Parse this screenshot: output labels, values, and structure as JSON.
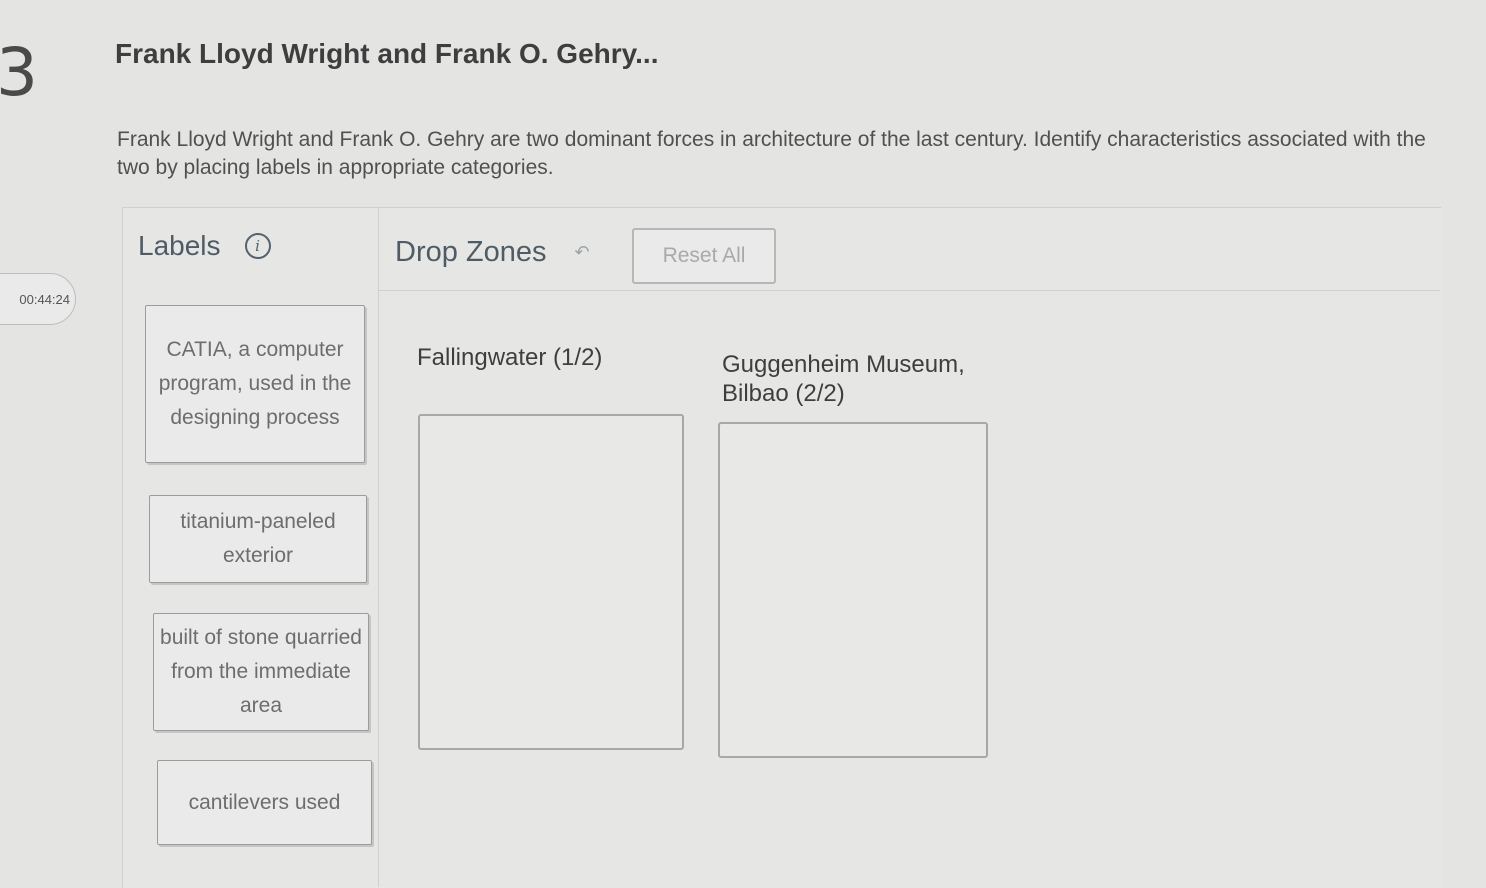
{
  "question": {
    "number": "3",
    "title": "Frank Lloyd Wright and Frank O. Gehry...",
    "prompt": "Frank Lloyd Wright and Frank O. Gehry are two dominant forces in architecture of the last century. Identify characteristics associated with the two by placing labels in appropriate categories."
  },
  "timer": {
    "value": "00:44:24"
  },
  "labels_panel": {
    "heading": "Labels",
    "info_icon_glyph": "i",
    "items": [
      {
        "text": "CATIA, a computer program, used in the designing process"
      },
      {
        "text": "titanium-paneled exterior"
      },
      {
        "text": "built of stone quarried from the immediate area"
      },
      {
        "text": "cantilevers used"
      }
    ]
  },
  "drop_zones_panel": {
    "heading": "Drop Zones",
    "undo_icon": "undo-arrow-icon",
    "reset_label": "Reset All",
    "zones": [
      {
        "title": "Fallingwater (1/2)"
      },
      {
        "title": "Guggenheim Museum, Bilbao (2/2)"
      }
    ]
  }
}
